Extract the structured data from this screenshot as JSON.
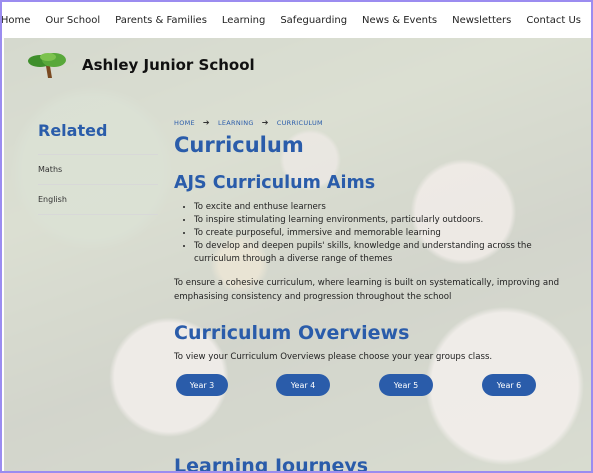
{
  "nav": {
    "items": [
      "Home",
      "Our School",
      "Parents & Families",
      "Learning",
      "Safeguarding",
      "News & Events",
      "Newsletters",
      "Contact Us"
    ]
  },
  "header": {
    "school_name": "Ashley Junior School"
  },
  "sidebar": {
    "title": "Related",
    "items": [
      {
        "label": "Maths"
      },
      {
        "label": "English"
      }
    ]
  },
  "breadcrumb": {
    "items": [
      "HOME",
      "LEARNING",
      "CURRICULUM"
    ]
  },
  "main": {
    "title": "Curriculum",
    "aims_heading": "AJS Curriculum Aims",
    "aims": [
      "To excite and enthuse learners",
      "To inspire stimulating learning environments, particularly outdoors.",
      "To create purposeful, immersive and memorable learning",
      "To develop and deepen pupils' skills, knowledge and understanding across the curriculum through a diverse range of themes"
    ],
    "cohesion_text": "To ensure a cohesive curriculum, where learning is built on systematically, improving and emphasising consistency and progression throughout the school",
    "overviews_heading": "Curriculum Overviews",
    "overviews_text": "To view your Curriculum Overviews please choose your year groups class.",
    "year_buttons": [
      "Year 3",
      "Year 4",
      "Year 5",
      "Year 6"
    ],
    "journeys_heading": "Learning Journeys"
  },
  "colors": {
    "accent": "#2a5caa",
    "frame": "#9b8cf0"
  },
  "icons": {
    "logo": "tree-logo-icon",
    "breadcrumb_separator": "arrow-right-icon"
  }
}
